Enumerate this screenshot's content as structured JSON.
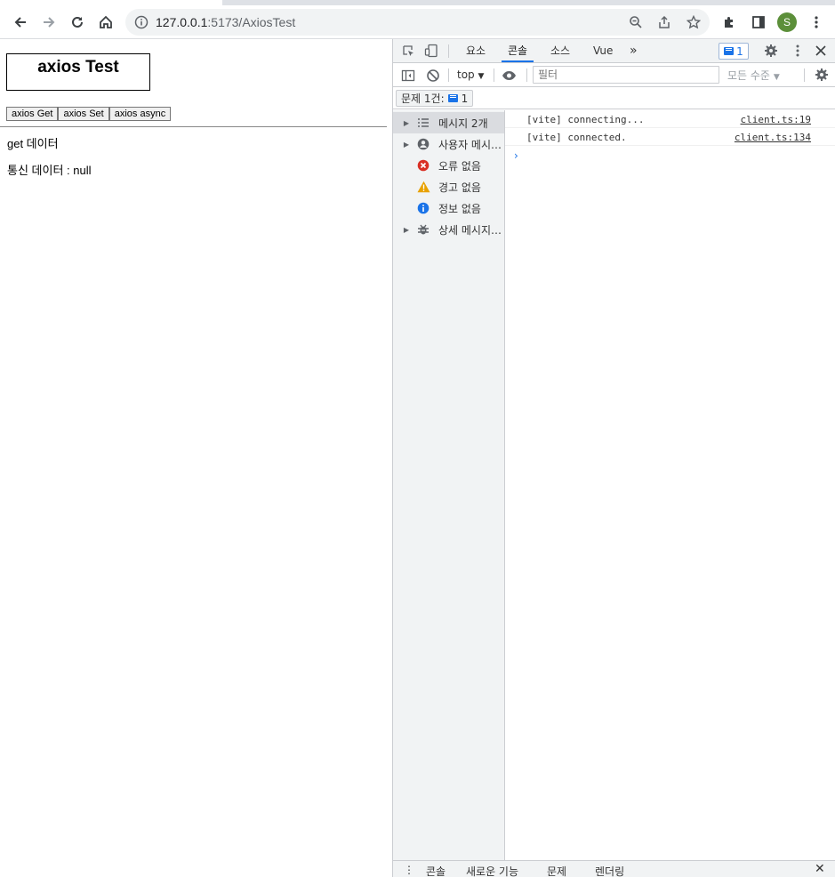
{
  "browser": {
    "url_host": "127.0.0.1",
    "url_path": ":5173/AxiosTest",
    "avatar_letter": "S",
    "accent": "#1a73e8"
  },
  "page": {
    "title": "axios Test",
    "buttons": [
      "axios Get",
      "axios Set",
      "axios async"
    ],
    "line1": "get 데이터",
    "line2": "통신 데이터 : null"
  },
  "devtools": {
    "tabs": [
      "요소",
      "콘솔",
      "소스",
      "Vue"
    ],
    "more": "»",
    "issue_badge": "1",
    "context": "top",
    "filter_placeholder": "필터",
    "levels": "모든 수준",
    "issues_label": "문제 1건:",
    "issues_count": "1",
    "sidebar": [
      {
        "label": "메시지 2개",
        "icon": "list-icon",
        "expandable": true
      },
      {
        "label": "사용자 메시지 없음",
        "icon": "user-icon",
        "expandable": true
      },
      {
        "label": "오류 없음",
        "icon": "error-icon",
        "expandable": false
      },
      {
        "label": "경고 없음",
        "icon": "warning-icon",
        "expandable": false
      },
      {
        "label": "정보 없음",
        "icon": "info-icon",
        "expandable": false
      },
      {
        "label": "상세 메시지 없음",
        "icon": "bug-icon",
        "expandable": true
      }
    ],
    "logs": [
      {
        "msg": "[vite] connecting...",
        "src": "client.ts:19"
      },
      {
        "msg": "[vite] connected.",
        "src": "client.ts:134"
      }
    ],
    "drawer_tabs": [
      "콘솔",
      "새로운 기능",
      "문제",
      "렌더링"
    ]
  }
}
